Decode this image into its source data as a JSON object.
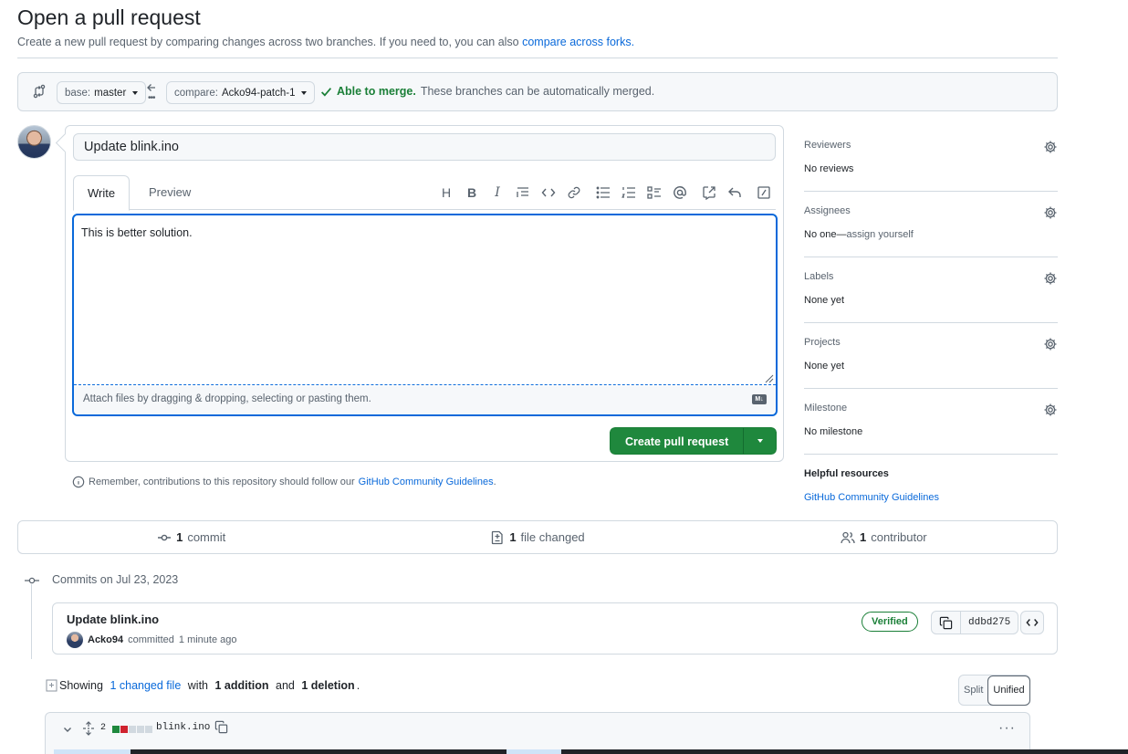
{
  "page": {
    "title": "Open a pull request",
    "subtitle_prefix": "Create a new pull request by comparing changes across two branches. If you need to, you can also",
    "subtitle_link": "compare across forks."
  },
  "range": {
    "base_label": "base:",
    "base_value": "master",
    "compare_label": "compare:",
    "compare_value": "Acko94-patch-1",
    "merge_ok": "Able to merge.",
    "merge_detail": "These branches can be automatically merged."
  },
  "composer": {
    "title_value": "Update blink.ino",
    "tab_write": "Write",
    "tab_preview": "Preview",
    "toolbar": {
      "heading": "H",
      "bold": "B",
      "italic": "I"
    },
    "body_value": "This is better solution.",
    "attach_hint": "Attach files by dragging & dropping, selecting or pasting them.",
    "markdown_badge": "M↓",
    "create_label": "Create pull request"
  },
  "guidelines": {
    "prefix": "Remember, contributions to this repository should follow our",
    "link": "GitHub Community Guidelines",
    "suffix": "."
  },
  "sidebar": {
    "reviewers": {
      "label": "Reviewers",
      "value": "No reviews"
    },
    "assignees": {
      "label": "Assignees",
      "value": "No one—",
      "action": "assign yourself"
    },
    "labels": {
      "label": "Labels",
      "value": "None yet"
    },
    "projects": {
      "label": "Projects",
      "value": "None yet"
    },
    "milestone": {
      "label": "Milestone",
      "value": "No milestone"
    },
    "help": {
      "label": "Helpful resources",
      "link": "GitHub Community Guidelines"
    }
  },
  "summary": {
    "commits_count": "1",
    "commits_label": "commit",
    "files_count": "1",
    "files_label": "file changed",
    "contributors_count": "1",
    "contributors_label": "contributor"
  },
  "commits": {
    "date_heading": "Commits on Jul 23, 2023",
    "items": [
      {
        "title": "Update blink.ino",
        "author": "Acko94",
        "action": "committed",
        "time": "1 minute ago",
        "badge": "Verified",
        "sha": "ddbd275"
      }
    ]
  },
  "diff": {
    "showing_prefix": "Showing",
    "changed_files": "1 changed file",
    "with": "with",
    "additions": "1 addition",
    "and": "and",
    "deletions": "1 deletion",
    "period": ".",
    "split_label": "Split",
    "unified_label": "Unified",
    "file": {
      "changes": "2",
      "name": "blink.ino",
      "more": "···"
    }
  },
  "colors": {
    "accent": "#0969da",
    "success": "#1f883d",
    "success_text": "#1a7f37",
    "deletion": "#cf222e",
    "border": "#d1d9e0"
  }
}
